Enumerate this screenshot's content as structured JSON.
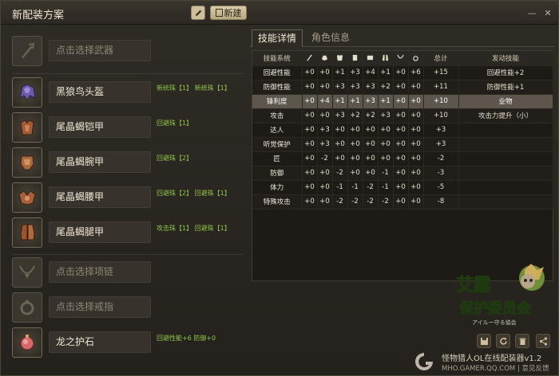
{
  "window": {
    "title": "新配装方案",
    "new_label": "新建",
    "minimize": "—",
    "close": "✕"
  },
  "slots": {
    "weapon": {
      "name": "点击选择武器",
      "gems": ""
    },
    "helm": {
      "name": "黑狼鸟头盔",
      "gems": "新统珠【1】  新统珠【1】"
    },
    "chest": {
      "name": "尾晶蝎铠甲",
      "gems": "回避珠【1】"
    },
    "arms": {
      "name": "尾晶蝎腕甲",
      "gems": "回避珠【2】"
    },
    "waist": {
      "name": "尾晶蝎腰甲",
      "gems": "回避珠【2】  回避珠【1】"
    },
    "legs": {
      "name": "尾晶蝎腿甲",
      "gems": "攻击珠【1】  回避珠【1】"
    },
    "necklace": {
      "name": "点击选择项链",
      "gems": ""
    },
    "ring": {
      "name": "点击选择戒指",
      "gems": ""
    },
    "charm": {
      "name": "龙之护石",
      "gems": "回避性能+6  防御+0"
    }
  },
  "tabs": {
    "skills": "技能详情",
    "character": "角色信息"
  },
  "table": {
    "headers": {
      "skill": "技能系统",
      "total": "总计",
      "active": "发动技能"
    },
    "rows": [
      {
        "name": "回避性能",
        "v": [
          "+0",
          "+0",
          "+1",
          "+3",
          "+4",
          "+1",
          "+0",
          "+6"
        ],
        "total": "+15",
        "active": "回避性能+2"
      },
      {
        "name": "防御性能",
        "v": [
          "+0",
          "+0",
          "+3",
          "+3",
          "+3",
          "+2",
          "+0",
          "+0"
        ],
        "total": "+11",
        "active": "防御性能+1"
      },
      {
        "name": "锋利度",
        "v": [
          "+0",
          "+4",
          "+1",
          "+1",
          "+3",
          "+1",
          "+0",
          "+0"
        ],
        "total": "+10",
        "active": "业物"
      },
      {
        "name": "攻击",
        "v": [
          "+0",
          "+0",
          "+3",
          "+2",
          "+2",
          "+3",
          "+0",
          "+0"
        ],
        "total": "+10",
        "active": "攻击力提升（小）"
      },
      {
        "name": "达人",
        "v": [
          "+0",
          "+3",
          "+0",
          "+0",
          "+0",
          "+0",
          "+0",
          "+0"
        ],
        "total": "+3",
        "active": ""
      },
      {
        "name": "听觉保护",
        "v": [
          "+0",
          "+3",
          "+0",
          "+0",
          "+0",
          "+0",
          "+0",
          "+0"
        ],
        "total": "+3",
        "active": ""
      },
      {
        "name": "匠",
        "v": [
          "+0",
          "-2",
          "+0",
          "+0",
          "+0",
          "+0",
          "+0",
          "+0"
        ],
        "total": "-2",
        "active": ""
      },
      {
        "name": "防御",
        "v": [
          "+0",
          "+0",
          "-2",
          "+0",
          "+0",
          "-1",
          "+0",
          "+0"
        ],
        "total": "-3",
        "active": ""
      },
      {
        "name": "体力",
        "v": [
          "+0",
          "+0",
          "-1",
          "-1",
          "-2",
          "-1",
          "+0",
          "+0"
        ],
        "total": "-5",
        "active": ""
      },
      {
        "name": "特殊攻击",
        "v": [
          "+0",
          "+0",
          "-2",
          "-2",
          "-2",
          "-2",
          "+0",
          "+0"
        ],
        "total": "-8",
        "active": ""
      }
    ]
  },
  "footer": {
    "logo_line1": "艾露",
    "logo_line2": "保护委员会",
    "logo_sub": "アイルー守る協会",
    "app_name": "怪物猎人OL在线配装器v1.2",
    "url": "MHO.GAMER.QQ.COM",
    "feedback": "意见反馈"
  },
  "colors": {
    "accent": "#cdbf9a",
    "gem_text": "#8fc54a",
    "highlight_row": "#5c564c"
  }
}
